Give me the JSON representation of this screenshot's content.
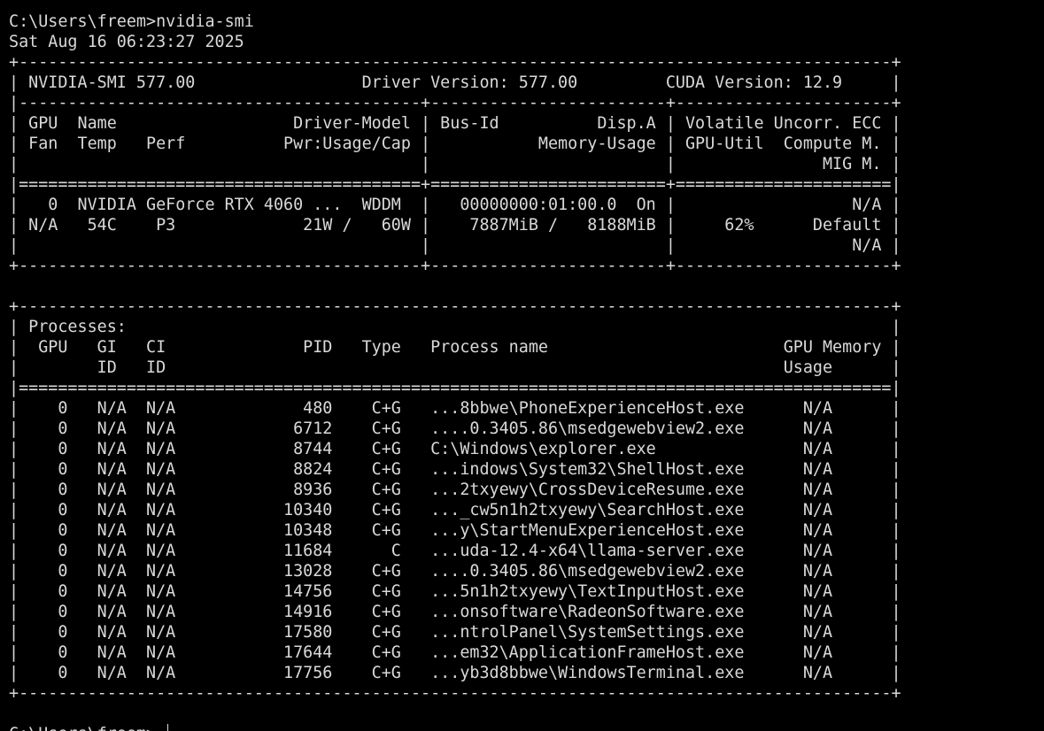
{
  "terminal": {
    "lines": [
      "C:\\Users\\freem>nvidia-smi",
      "Sat Aug 16 06:23:27 2025",
      "+-----------------------------------------------------------------------------------------+",
      "| NVIDIA-SMI 577.00                 Driver Version: 577.00         CUDA Version: 12.9     |",
      "|-----------------------------------------+------------------------+----------------------+",
      "| GPU  Name                  Driver-Model | Bus-Id          Disp.A | Volatile Uncorr. ECC |",
      "| Fan  Temp   Perf          Pwr:Usage/Cap |           Memory-Usage | GPU-Util  Compute M. |",
      "|                                         |                        |               MIG M. |",
      "|=========================================+========================+======================|",
      "|   0  NVIDIA GeForce RTX 4060 ...  WDDM  |   00000000:01:00.0  On |                  N/A |",
      "| N/A   54C    P3             21W /   60W |    7887MiB /   8188MiB |     62%      Default |",
      "|                                         |                        |                  N/A |",
      "+-----------------------------------------+------------------------+----------------------+",
      "",
      "+-----------------------------------------------------------------------------------------+",
      "| Processes:                                                                              |",
      "|  GPU   GI   CI              PID   Type   Process name                        GPU Memory |",
      "|        ID   ID                                                               Usage      |",
      "|=========================================================================================|",
      "|    0   N/A  N/A             480    C+G   ...8bbwe\\PhoneExperienceHost.exe      N/A      |",
      "|    0   N/A  N/A            6712    C+G   ....0.3405.86\\msedgewebview2.exe      N/A      |",
      "|    0   N/A  N/A            8744    C+G   C:\\Windows\\explorer.exe               N/A      |",
      "|    0   N/A  N/A            8824    C+G   ...indows\\System32\\ShellHost.exe      N/A      |",
      "|    0   N/A  N/A            8936    C+G   ...2txyewy\\CrossDeviceResume.exe      N/A      |",
      "|    0   N/A  N/A           10340    C+G   ..._cw5n1h2txyewy\\SearchHost.exe      N/A      |",
      "|    0   N/A  N/A           10348    C+G   ...y\\StartMenuExperienceHost.exe      N/A      |",
      "|    0   N/A  N/A           11684      C   ...uda-12.4-x64\\llama-server.exe      N/A      |",
      "|    0   N/A  N/A           13028    C+G   ....0.3405.86\\msedgewebview2.exe      N/A      |",
      "|    0   N/A  N/A           14756    C+G   ...5n1h2txyewy\\TextInputHost.exe      N/A      |",
      "|    0   N/A  N/A           14916    C+G   ...onsoftware\\RadeonSoftware.exe      N/A      |",
      "|    0   N/A  N/A           17580    C+G   ...ntrolPanel\\SystemSettings.exe      N/A      |",
      "|    0   N/A  N/A           17644    C+G   ...em32\\ApplicationFrameHost.exe      N/A      |",
      "|    0   N/A  N/A           17756    C+G   ...yb3d8bbwe\\WindowsTerminal.exe      N/A      |",
      "+-----------------------------------------------------------------------------------------+",
      "",
      "C:\\Users\\freem>"
    ]
  }
}
